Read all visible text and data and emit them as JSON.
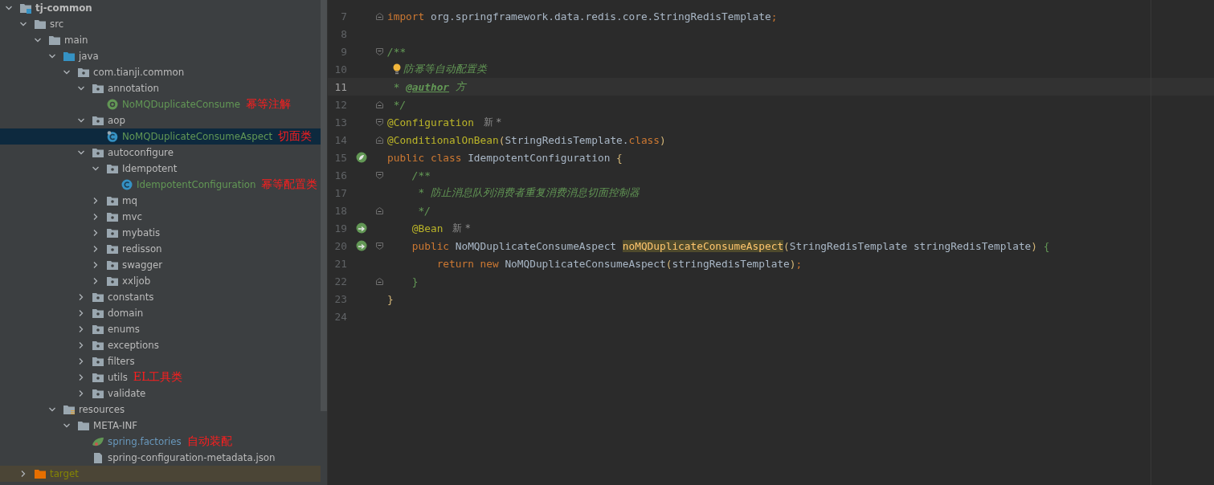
{
  "project_tree": {
    "items": [
      {
        "label": "tj-common",
        "kind": "module",
        "expanded": true,
        "selected": false,
        "children": [
          {
            "label": "src",
            "kind": "folder",
            "expanded": true,
            "selected": false,
            "children": [
              {
                "label": "main",
                "kind": "folder",
                "expanded": true,
                "selected": false,
                "children": [
                  {
                    "label": "java",
                    "kind": "source-root",
                    "expanded": true,
                    "selected": false,
                    "children": [
                      {
                        "label": "com.tianji.common",
                        "kind": "package",
                        "expanded": true,
                        "selected": false,
                        "children": [
                          {
                            "label": "annotation",
                            "kind": "package",
                            "expanded": true,
                            "selected": false,
                            "children": [
                              {
                                "label": "NoMQDuplicateConsume",
                                "kind": "annotation",
                                "color": "#629755",
                                "selected": false,
                                "note": "幂等注解"
                              }
                            ]
                          },
                          {
                            "label": "aop",
                            "kind": "package",
                            "expanded": true,
                            "selected": false,
                            "children": [
                              {
                                "label": "NoMQDuplicateConsumeAspect",
                                "kind": "aspect",
                                "color": "#629755",
                                "selected": true,
                                "note": "切面类"
                              }
                            ]
                          },
                          {
                            "label": "autoconfigure",
                            "kind": "package",
                            "expanded": true,
                            "selected": false,
                            "children": [
                              {
                                "label": "Idempotent",
                                "kind": "package",
                                "expanded": true,
                                "selected": false,
                                "children": [
                                  {
                                    "label": "IdempotentConfiguration",
                                    "kind": "class",
                                    "color": "#629755",
                                    "selected": false,
                                    "note": "幂等配置类"
                                  }
                                ]
                              },
                              {
                                "label": "mq",
                                "kind": "package",
                                "expanded": false,
                                "selected": false
                              },
                              {
                                "label": "mvc",
                                "kind": "package",
                                "expanded": false,
                                "selected": false
                              },
                              {
                                "label": "mybatis",
                                "kind": "package",
                                "expanded": false,
                                "selected": false
                              },
                              {
                                "label": "redisson",
                                "kind": "package",
                                "expanded": false,
                                "selected": false
                              },
                              {
                                "label": "swagger",
                                "kind": "package",
                                "expanded": false,
                                "selected": false
                              },
                              {
                                "label": "xxljob",
                                "kind": "package",
                                "expanded": false,
                                "selected": false
                              }
                            ]
                          },
                          {
                            "label": "constants",
                            "kind": "package",
                            "expanded": false,
                            "selected": false
                          },
                          {
                            "label": "domain",
                            "kind": "package",
                            "expanded": false,
                            "selected": false
                          },
                          {
                            "label": "enums",
                            "kind": "package",
                            "expanded": false,
                            "selected": false
                          },
                          {
                            "label": "exceptions",
                            "kind": "package",
                            "expanded": false,
                            "selected": false
                          },
                          {
                            "label": "filters",
                            "kind": "package",
                            "expanded": false,
                            "selected": false
                          },
                          {
                            "label": "utils",
                            "kind": "package",
                            "expanded": false,
                            "selected": false,
                            "note": "EL工具类"
                          },
                          {
                            "label": "validate",
                            "kind": "package",
                            "expanded": false,
                            "selected": false
                          }
                        ]
                      }
                    ]
                  },
                  {
                    "label": "resources",
                    "kind": "resource-root",
                    "expanded": true,
                    "selected": false,
                    "children": [
                      {
                        "label": "META-INF",
                        "kind": "folder",
                        "expanded": true,
                        "selected": false,
                        "children": [
                          {
                            "label": "spring.factories",
                            "kind": "spring-file",
                            "color": "#6897bb",
                            "selected": false,
                            "note": "自动装配"
                          },
                          {
                            "label": "spring-configuration-metadata.json",
                            "kind": "json-file",
                            "selected": false
                          }
                        ]
                      }
                    ]
                  }
                ]
              }
            ]
          },
          {
            "label": "target",
            "kind": "excluded",
            "expanded": false,
            "selected": false,
            "color": "#848504"
          }
        ]
      }
    ]
  },
  "editor": {
    "lines": [
      {
        "number": "7",
        "fold_end": true,
        "segments": [
          {
            "kind": "keyword",
            "text": "import"
          },
          {
            "kind": "plain",
            "text": " org.springframework.data.redis.core.StringRedisTemplate"
          },
          {
            "kind": "keyword",
            "text": ";"
          }
        ]
      },
      {
        "number": "8"
      },
      {
        "number": "9",
        "fold_start": true,
        "segments": [
          {
            "kind": "comment",
            "text": "/**"
          }
        ]
      },
      {
        "number": "10",
        "bulb": true,
        "segments": [
          {
            "kind": "comment",
            "text": "防幂等自动配置类"
          }
        ]
      },
      {
        "number": "11",
        "current": true,
        "segments": [
          {
            "kind": "comment",
            "text": " * "
          },
          {
            "kind": "doc-tag",
            "text": "@author"
          },
          {
            "kind": "comment",
            "text": " 方"
          }
        ]
      },
      {
        "number": "12",
        "fold_end": true,
        "segments": [
          {
            "kind": "comment",
            "text": " */"
          }
        ]
      },
      {
        "number": "13",
        "fold_start": true,
        "hint": "新 *",
        "segments": [
          {
            "kind": "annotation",
            "text": "@Configuration"
          }
        ]
      },
      {
        "number": "14",
        "fold_end": true,
        "segments": [
          {
            "kind": "annotation",
            "text": "@ConditionalOnBean"
          },
          {
            "kind": "paren",
            "text": "("
          },
          {
            "kind": "plain",
            "text": "StringRedisTemplate."
          },
          {
            "kind": "keyword",
            "text": "class"
          },
          {
            "kind": "paren",
            "text": ")"
          }
        ]
      },
      {
        "number": "15",
        "bean": true,
        "segments": [
          {
            "kind": "keyword",
            "text": "public class"
          },
          {
            "kind": "plain",
            "text": " IdempotentConfiguration "
          },
          {
            "kind": "paren",
            "text": "{"
          }
        ]
      },
      {
        "number": "16",
        "fold_start": true,
        "segments": [
          {
            "kind": "comment",
            "text": "    /**"
          }
        ]
      },
      {
        "number": "17",
        "segments": [
          {
            "kind": "comment",
            "text": "     * 防止消息队列消费者重复消费消息切面控制器"
          }
        ]
      },
      {
        "number": "18",
        "fold_end": true,
        "segments": [
          {
            "kind": "comment",
            "text": "     */"
          }
        ]
      },
      {
        "number": "19",
        "bean_link": true,
        "hint": "新 *",
        "segments": [
          {
            "kind": "annotation",
            "text": "    @Bean"
          }
        ]
      },
      {
        "number": "20",
        "bean_link": true,
        "fold_start": true,
        "segments": [
          {
            "kind": "keyword",
            "text": "    public"
          },
          {
            "kind": "plain",
            "text": " NoMQDuplicateConsumeAspect "
          },
          {
            "kind": "method-highlight",
            "text": "noMQDuplicateConsumeAspect"
          },
          {
            "kind": "paren",
            "text": "("
          },
          {
            "kind": "plain",
            "text": "StringRedisTemplate stringRedisTemplate"
          },
          {
            "kind": "paren",
            "text": ")"
          },
          {
            "kind": "brace",
            "text": " {"
          }
        ]
      },
      {
        "number": "21",
        "segments": [
          {
            "kind": "keyword",
            "text": "        return new"
          },
          {
            "kind": "plain",
            "text": " NoMQDuplicateConsumeAspect"
          },
          {
            "kind": "paren",
            "text": "("
          },
          {
            "kind": "plain",
            "text": "stringRedisTemplate"
          },
          {
            "kind": "paren",
            "text": ")"
          },
          {
            "kind": "keyword",
            "text": ";"
          }
        ]
      },
      {
        "number": "22",
        "fold_end": true,
        "segments": [
          {
            "kind": "brace",
            "text": "    }"
          }
        ]
      },
      {
        "number": "23",
        "segments": [
          {
            "kind": "paren",
            "text": "}"
          }
        ]
      },
      {
        "number": "24"
      }
    ]
  }
}
